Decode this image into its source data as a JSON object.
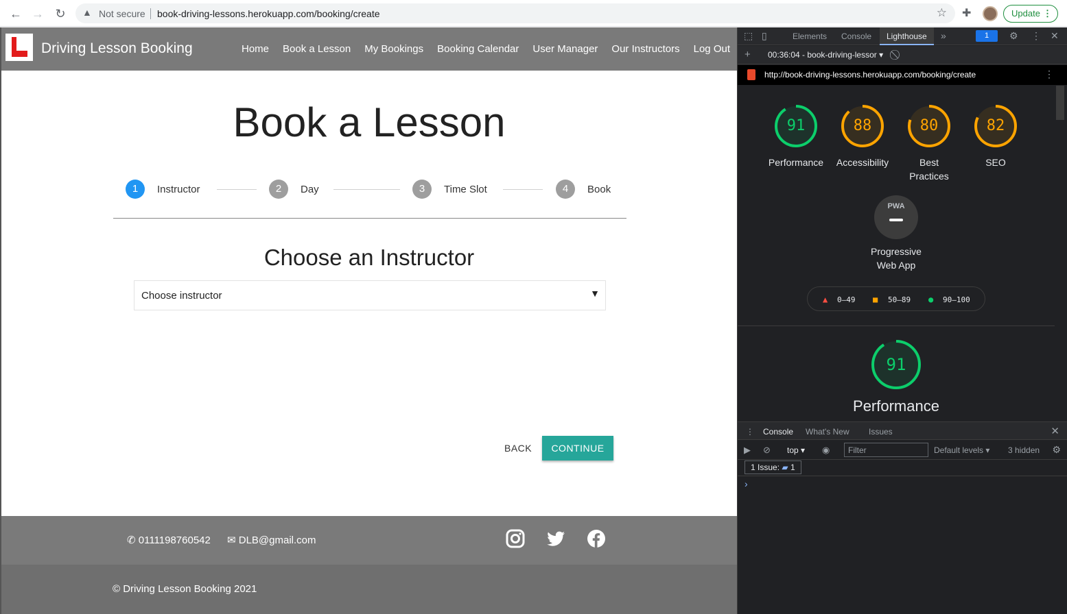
{
  "browser": {
    "security_text": "Not secure",
    "url": "book-driving-lessons.herokuapp.com/booking/create",
    "update_label": "Update"
  },
  "site": {
    "brand": "Driving Lesson Booking",
    "nav": [
      "Home",
      "Book a Lesson",
      "My Bookings",
      "Booking Calendar",
      "User Manager",
      "Our Instructors",
      "Log Out"
    ],
    "page_title": "Book a Lesson",
    "steps": [
      {
        "num": "1",
        "label": "Instructor"
      },
      {
        "num": "2",
        "label": "Day"
      },
      {
        "num": "3",
        "label": "Time Slot"
      },
      {
        "num": "4",
        "label": "Book"
      }
    ],
    "section_title": "Choose an Instructor",
    "select_value": "Choose instructor",
    "back_label": "BACK",
    "continue_label": "CONTINUE",
    "phone": "0111198760542",
    "email": "DLB@gmail.com",
    "copyright": "© Driving Lesson Booking 2021",
    "colors": {
      "accent": "#26a69a",
      "step_active": "#2196f3",
      "nav_bg": "#7a7a7a"
    }
  },
  "devtools": {
    "tabs": [
      "Elements",
      "Console",
      "Lighthouse"
    ],
    "issues_count": "1",
    "report_label": "00:36:04 - book-driving-lessor",
    "report_url": "http://book-driving-lessons.herokuapp.com/booking/create",
    "scores": [
      {
        "value": "91",
        "label": "Performance",
        "color": "#0cce6b"
      },
      {
        "value": "88",
        "label": "Accessibility",
        "color": "#ffa400"
      },
      {
        "value": "80",
        "label": "Best Practices",
        "color": "#ffa400"
      },
      {
        "value": "82",
        "label": "SEO",
        "color": "#ffa400"
      }
    ],
    "pwa_badge": "PWA",
    "pwa_label": "Progressive Web App",
    "legend": [
      "0–49",
      "50–89",
      "90–100"
    ],
    "big_score": "91",
    "big_label": "Performance",
    "drawer_tabs": [
      "Console",
      "What's New",
      "Issues"
    ],
    "context": "top",
    "filter_placeholder": "Filter",
    "levels": "Default levels",
    "hidden": "3 hidden",
    "issue_text": "1 Issue:",
    "issue_count": "1"
  }
}
